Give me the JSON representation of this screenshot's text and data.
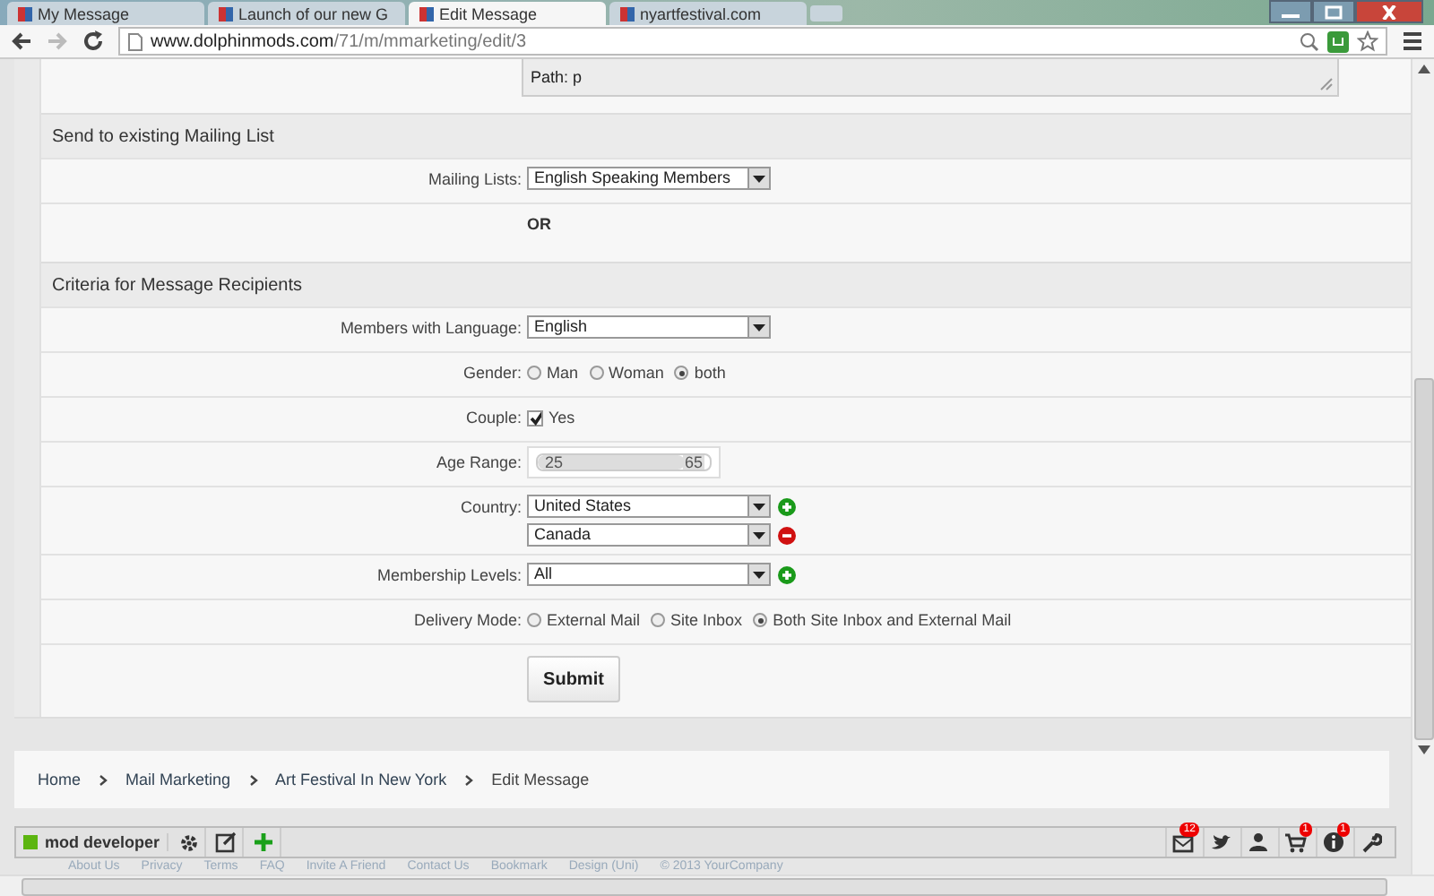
{
  "browser": {
    "tabs": [
      {
        "title": "My Message",
        "selected": false
      },
      {
        "title": "Launch of our new G",
        "selected": false
      },
      {
        "title": "Edit Message",
        "selected": true
      },
      {
        "title": "nyartfestival.com",
        "selected": false
      }
    ],
    "url_host": "www.dolphinmods.com",
    "url_path": "/71/m/mmarketing/edit/3"
  },
  "editor_path": "Path: p",
  "sections": [
    {
      "title": "Send to existing Mailing List",
      "rows": [
        {
          "kind": "select",
          "label": "Mailing Lists:",
          "options": [
            {
              "value": "English Speaking Members",
              "kind": "plain"
            }
          ]
        },
        {
          "kind": "separator",
          "text": "OR"
        }
      ]
    },
    {
      "title": "Criteria for Message Recipients",
      "rows": [
        {
          "kind": "select",
          "label": "Members with Language:",
          "options": [
            {
              "value": "English",
              "kind": "plain"
            }
          ]
        },
        {
          "kind": "radio",
          "label": "Gender:",
          "choices": [
            {
              "label": "Man",
              "selected": false
            },
            {
              "label": "Woman",
              "selected": false
            },
            {
              "label": "both",
              "selected": true
            }
          ]
        },
        {
          "kind": "checkbox",
          "label": "Couple:",
          "text": "Yes",
          "checked": true
        },
        {
          "kind": "range",
          "label": "Age Range:",
          "min": "25",
          "max": "65",
          "level": 0.85
        },
        {
          "kind": "select",
          "label": "Country:",
          "options": [
            {
              "value": "United States",
              "kind": "add"
            },
            {
              "value": "Canada",
              "kind": "remove"
            }
          ]
        },
        {
          "kind": "select",
          "label": "Membership Levels:",
          "options": [
            {
              "value": "All",
              "kind": "add"
            }
          ]
        },
        {
          "kind": "radio",
          "label": "Delivery Mode:",
          "choices": [
            {
              "label": "External Mail",
              "selected": false
            },
            {
              "label": "Site Inbox",
              "selected": false
            },
            {
              "label": "Both Site Inbox and External Mail",
              "selected": true
            }
          ]
        },
        {
          "kind": "submit",
          "text": "Submit"
        }
      ]
    }
  ],
  "breadcrumb": [
    "Home",
    "Mail Marketing",
    "Art Festival In New York",
    "Edit Message"
  ],
  "toolbar": {
    "user": "mod developer",
    "badges": [
      {
        "kind": "mail",
        "count": "12"
      },
      {
        "kind": "bird"
      },
      {
        "kind": "person"
      },
      {
        "kind": "cart",
        "count": "1"
      },
      {
        "kind": "info",
        "count": "1"
      },
      {
        "kind": "wrench"
      }
    ]
  },
  "footer_links": [
    "About Us",
    "Privacy",
    "Terms",
    "FAQ",
    "Invite A Friend",
    "Contact Us",
    "Bookmark",
    "Design (Uni)",
    "© 2013 YourCompany"
  ]
}
